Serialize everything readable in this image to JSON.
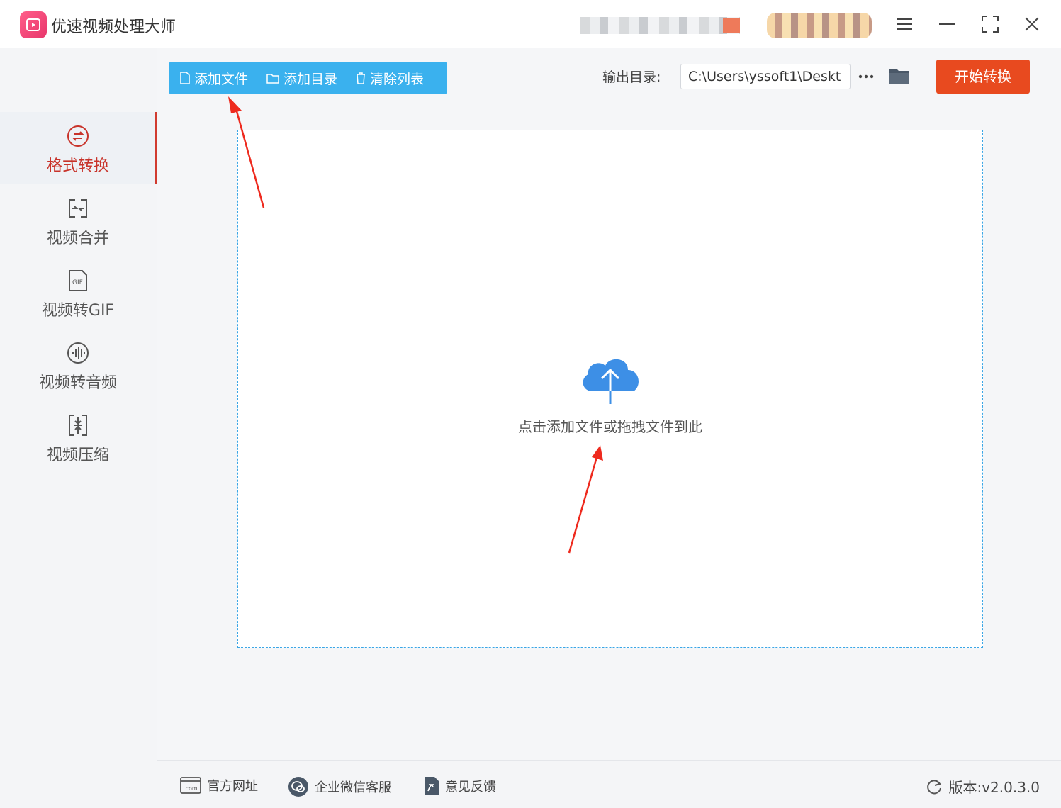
{
  "app": {
    "title": "优速视频处理大师"
  },
  "sidebar": {
    "items": [
      {
        "label": "格式转换",
        "icon": "convert-circle-icon",
        "active": true
      },
      {
        "label": "视频合并",
        "icon": "merge-icon"
      },
      {
        "label": "视频转GIF",
        "icon": "gif-file-icon"
      },
      {
        "label": "视频转音频",
        "icon": "audio-wave-icon"
      },
      {
        "label": "视频压缩",
        "icon": "compress-icon"
      }
    ]
  },
  "toolbar": {
    "add_file": "添加文件",
    "add_folder": "添加目录",
    "clear_list": "清除列表",
    "output_label": "输出目录:",
    "output_path": "C:\\Users\\yssoft1\\Deskt",
    "start": "开始转换"
  },
  "dropzone": {
    "hint": "点击添加文件或拖拽文件到此",
    "icon": "cloud-upload-icon"
  },
  "footer": {
    "website": "官方网址",
    "wechat": "企业微信客服",
    "feedback": "意见反馈",
    "version": "版本:v2.0.3.0"
  },
  "colors": {
    "accent_blue": "#3ab1ee",
    "start_red": "#e84a1f",
    "active_red": "#c8332a"
  }
}
